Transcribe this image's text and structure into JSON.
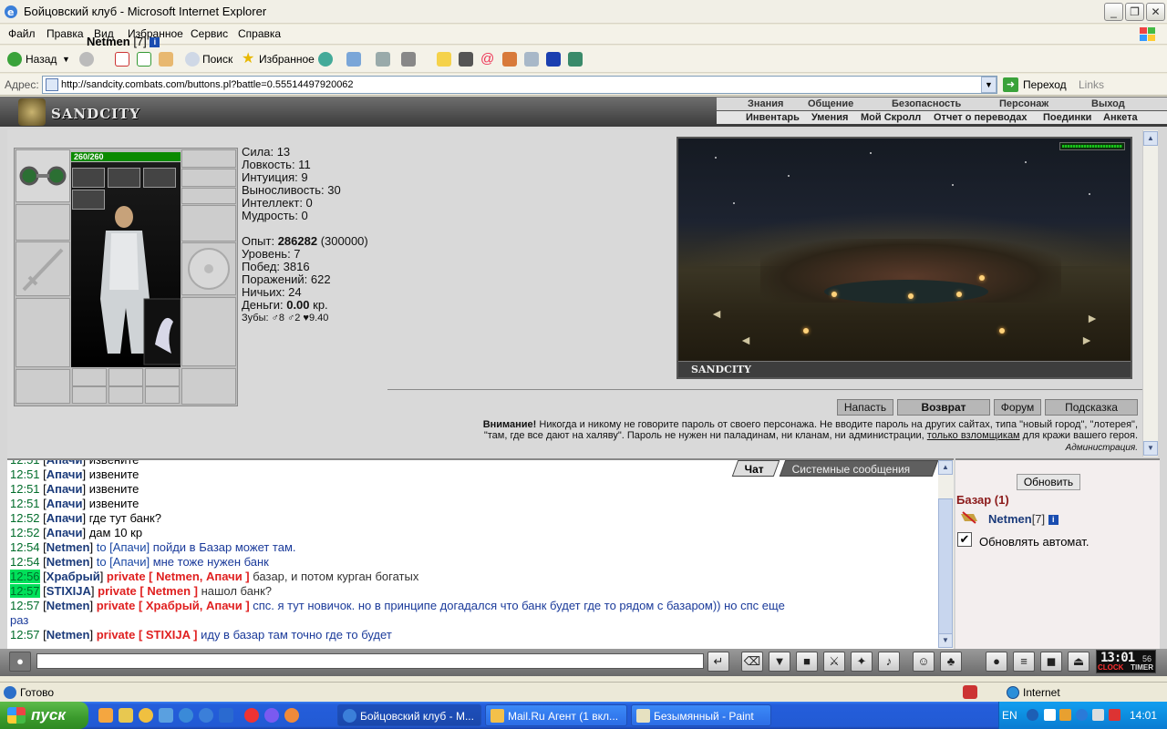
{
  "window": {
    "title": "Бойцовский клуб - Microsoft Internet Explorer",
    "controls": [
      "_",
      "❐",
      "✕"
    ]
  },
  "menu": [
    "Файл",
    "Правка",
    "Вид",
    "Избранное",
    "Сервис",
    "Справка"
  ],
  "toolbar": {
    "back": "Назад",
    "search": "Поиск",
    "favorites": "Избранное"
  },
  "address": {
    "label": "Адрес:",
    "url": "http://sandcity.combats.com/buttons.pl?battle=0.55514497920062",
    "go": "Переход",
    "links": "Links"
  },
  "game": {
    "logo": "SANDCITY",
    "nav_top": [
      "Знания",
      "Общение",
      "Безопасность",
      "Персонаж",
      "Выход"
    ],
    "nav_sub": [
      "Инвентарь",
      "Умения",
      "Мой Скролл",
      "Отчет о переводах",
      "Поединки",
      "Анкета"
    ],
    "character": {
      "name": "Netmen",
      "level": "[7]",
      "hp": "260/260",
      "stats": {
        "strength": "Сила: 13",
        "agility": "Ловкость: 11",
        "intuition": "Интуиция: 9",
        "endurance": "Выносливость: 30",
        "intellect": "Интеллект: 0",
        "wisdom": "Мудрость: 0"
      },
      "exp_label": "Опыт: ",
      "exp_value": "286282",
      "exp_next": " (300000)",
      "level_line": "Уровень: 7",
      "wins": "Побед: 3816",
      "losses": "Поражений: 622",
      "draws": "Ничьих: 24",
      "money_label": "Деньги: ",
      "money_value": "0.00",
      "money_unit": " кр.",
      "teeth": "Зубы: ♂8 ♂2 ♥9.40"
    },
    "map_label": "SANDCITY",
    "buttons": {
      "attack": "Напасть",
      "back": "Возврат",
      "forum": "Форум",
      "hint": "Подсказка"
    },
    "warning": {
      "bold": "Внимание!",
      "line1": " Никогда и никому не говорите пароль от своего персонажа. Не вводите пароль на других сайтах, типа \"новый город\", \"лотерея\",",
      "line2a": "\"там, где все дают на халяву\". Пароль не нужен ни паладинам, ни кланам, ни администрации, ",
      "line2_link": "только взломщикам",
      "line2b": " для кражи вашего героя.",
      "signature": "Администрация."
    }
  },
  "chat": {
    "tabs": [
      "Чат",
      "Системные сообщения"
    ],
    "lines": [
      {
        "time": "12:51",
        "nick": "Апачи",
        "to": "",
        "private": "",
        "text": " извените",
        "style": "black",
        "hl": false
      },
      {
        "time": "12:51",
        "nick": "Апачи",
        "to": "",
        "private": "",
        "text": " извените",
        "style": "black",
        "hl": false
      },
      {
        "time": "12:51",
        "nick": "Апачи",
        "to": "",
        "private": "",
        "text": " извените",
        "style": "black",
        "hl": false
      },
      {
        "time": "12:51",
        "nick": "Апачи",
        "to": "",
        "private": "",
        "text": " извените",
        "style": "black",
        "hl": false
      },
      {
        "time": "12:52",
        "nick": "Апачи",
        "to": "",
        "private": "",
        "text": " где тут банк?",
        "style": "black",
        "hl": false
      },
      {
        "time": "12:52",
        "nick": "Апачи",
        "to": "",
        "private": "",
        "text": " дам 10 кр",
        "style": "black",
        "hl": false
      },
      {
        "time": "12:54",
        "nick": "Netmen",
        "to": " to [Апачи]",
        "private": "",
        "text": " пойди в Базар может там.",
        "style": "blue",
        "hl": false
      },
      {
        "time": "12:54",
        "nick": "Netmen",
        "to": " to [Апачи]",
        "private": "",
        "text": " мне тоже нужен банк",
        "style": "blue",
        "hl": false
      },
      {
        "time": "12:56",
        "nick": "Храбрый",
        "to": "",
        "private": " private [ Netmen, Апачи ]",
        "text": " базар, и потом курган богатых",
        "style": "gray",
        "hl": true
      },
      {
        "time": "12:57",
        "nick": "STIXIJA",
        "to": "",
        "private": " private [ Netmen ]",
        "text": " нашол банк?",
        "style": "gray",
        "hl": true
      },
      {
        "time": "12:57",
        "nick": "Netmen",
        "to": "",
        "private": " private [ Храбрый, Апачи ]",
        "text": " спс. я тут новичок. но в принципе догадался что банк будет где то рядом с базаром)) но спс еще",
        "style": "blue",
        "hl": false
      },
      {
        "time": "",
        "nick": "",
        "to": "",
        "private": "",
        "text": "раз",
        "style": "blue",
        "hl": false
      },
      {
        "time": "12:57",
        "nick": "Netmen",
        "to": "",
        "private": " private [ STIXIJA ]",
        "text": " иду в базар там точно где то будет",
        "style": "blue",
        "hl": false
      }
    ]
  },
  "users": {
    "refresh": "Обновить",
    "room": "Базар (1)",
    "user_name": "Netmen",
    "user_level": "[7]",
    "auto_refresh": "Обновлять автомат."
  },
  "clock": {
    "time": "13:01",
    "sec": "56",
    "label1": "CLOCK",
    "label2": "TIMER"
  },
  "status": {
    "text": "Готово",
    "zone": "Internet"
  },
  "taskbar": {
    "start": "пуск",
    "tasks": [
      "Бойцовский клуб - М...",
      "Mail.Ru Агент (1 вкл...",
      "Безымянный - Paint"
    ],
    "lang": "EN",
    "time": "14:01"
  },
  "colors": {
    "taskbar": "#245edb",
    "start": "#3a9a2c",
    "chat_time": "#006c2a",
    "chat_private": "#e02020",
    "room_title": "#8b1a1a"
  }
}
